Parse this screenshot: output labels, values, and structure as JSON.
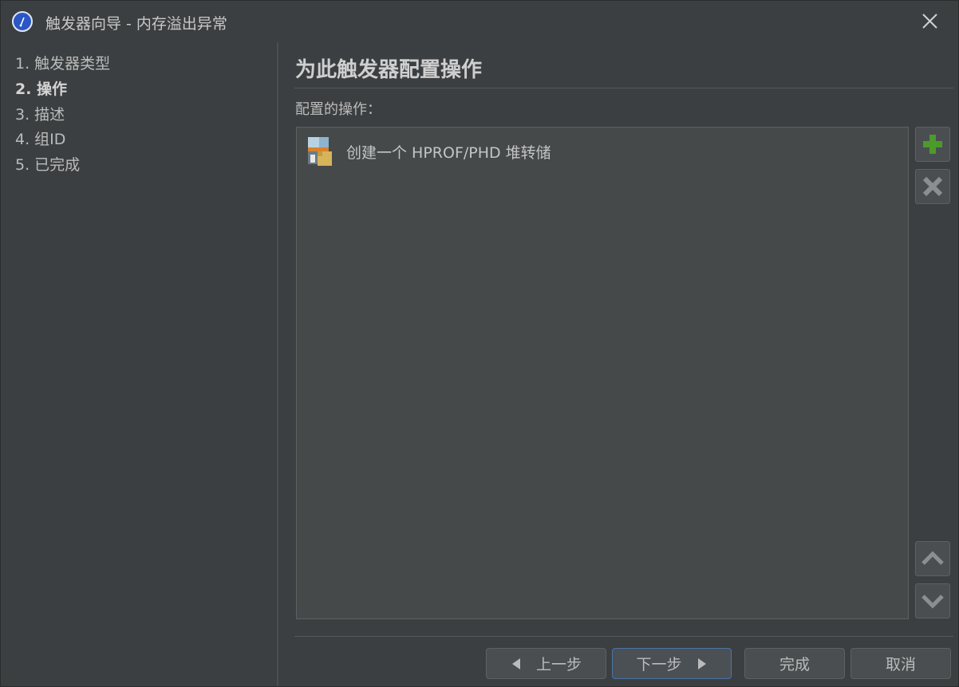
{
  "window": {
    "title": "触发器向导 - 内存溢出异常",
    "app_icon": "compass-icon",
    "close_icon": "close-icon"
  },
  "steps": [
    {
      "label": "1. 触发器类型",
      "active": false
    },
    {
      "label": "2. 操作",
      "active": true
    },
    {
      "label": "3. 描述",
      "active": false
    },
    {
      "label": "4. 组ID",
      "active": false
    },
    {
      "label": "5. 已完成",
      "active": false
    }
  ],
  "main": {
    "heading": "为此触发器配置操作",
    "actions_label": "配置的操作：",
    "actions": [
      {
        "label": "创建一个 HPROF/PHD 堆转储",
        "icon": "heap-dump-icon"
      }
    ],
    "side_buttons": {
      "add": "plus-icon",
      "remove": "x-icon",
      "up": "chevron-up-icon",
      "down": "chevron-down-icon"
    }
  },
  "footer": {
    "back": "上一步",
    "next": "下一步",
    "finish": "完成",
    "cancel": "取消"
  },
  "colors": {
    "background": "#3c3f41",
    "list_background": "#45494a",
    "add_green": "#4c9a2a",
    "primary_border": "#4a74a8"
  }
}
